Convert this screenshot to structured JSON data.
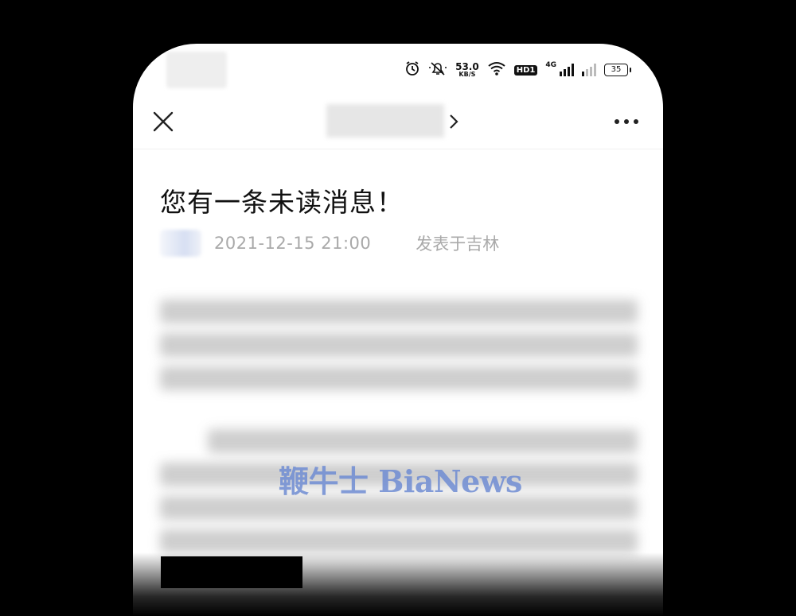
{
  "status_bar": {
    "speed_value": "53.0",
    "speed_unit": "KB/S",
    "hd_label": "HD1",
    "network_label": "4G",
    "battery": "35"
  },
  "article": {
    "title": "您有一条未读消息！",
    "timestamp": "2021-12-15 21:00",
    "location": "发表于吉林"
  },
  "watermark": "鞭牛士 BiaNews",
  "icons": [
    "alarm-icon",
    "mute-icon",
    "wifi-icon",
    "signal-icon",
    "close-icon",
    "chevron-right-icon",
    "more-icon"
  ]
}
